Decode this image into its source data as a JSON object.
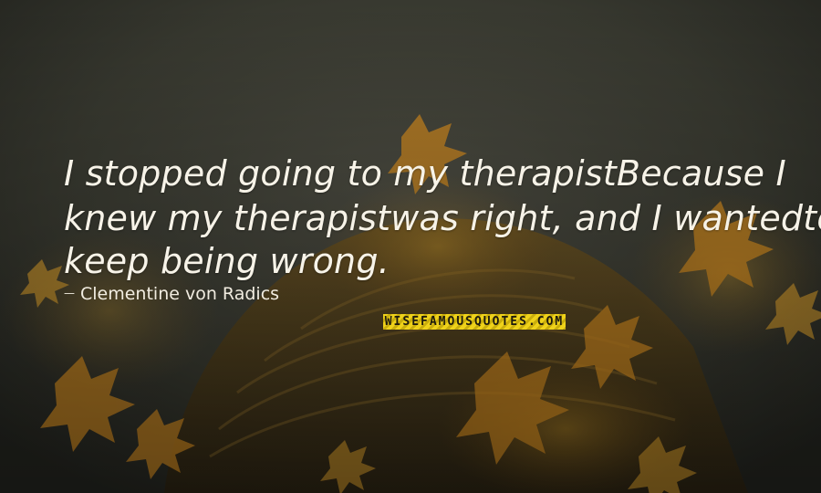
{
  "quote": {
    "lines": [
      "I stopped going to my therapistBecause I",
      "knew my therapistwas right, and I wantedto",
      "keep being wrong."
    ]
  },
  "author": {
    "dash": "—",
    "name": "Clementine von Radics"
  },
  "watermark": {
    "text": "WISEFAMOUSQUOTES.COM"
  },
  "colors": {
    "text": "#f7f3e8",
    "watermark_bg": "#efd21a",
    "sky": "#3a3b33",
    "leaves": "#c98a22"
  }
}
